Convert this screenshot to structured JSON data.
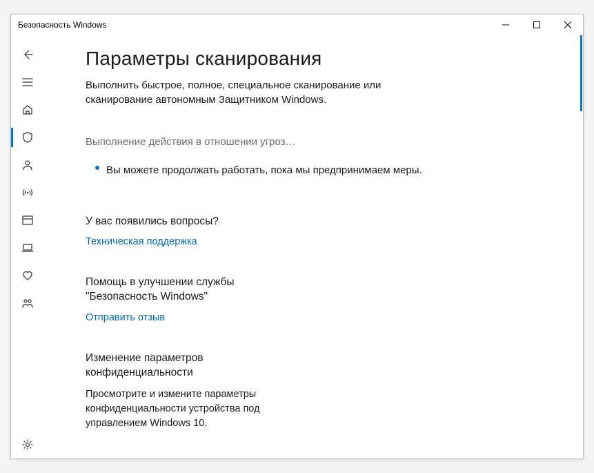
{
  "window": {
    "title": "Безопасность Windows"
  },
  "sidebar": {
    "back": "back",
    "menu": "menu",
    "home": "home",
    "shield": "shield",
    "account": "account",
    "firewall": "firewall",
    "app": "app",
    "device": "device",
    "health": "health",
    "family": "family",
    "settings": "settings"
  },
  "page": {
    "title": "Параметры сканирования",
    "subtitle": "Выполнить быстрое, полное, специальное сканирование или сканирование автономным Защитником Windows.",
    "status": "Выполнение действия в отношении угроз…",
    "status_detail": "Вы можете продолжать работать, пока мы предпринимаем меры."
  },
  "sections": {
    "help": {
      "title": "У вас появились вопросы?",
      "link": "Техническая поддержка"
    },
    "feedback": {
      "title": "Помощь в улучшении службы \"Безопасность Windows\"",
      "link": "Отправить отзыв"
    },
    "privacy": {
      "title": "Изменение параметров конфиденциальности",
      "body": "Просмотрите и измените параметры конфиденциальности устройства под управлением Windows 10."
    }
  }
}
